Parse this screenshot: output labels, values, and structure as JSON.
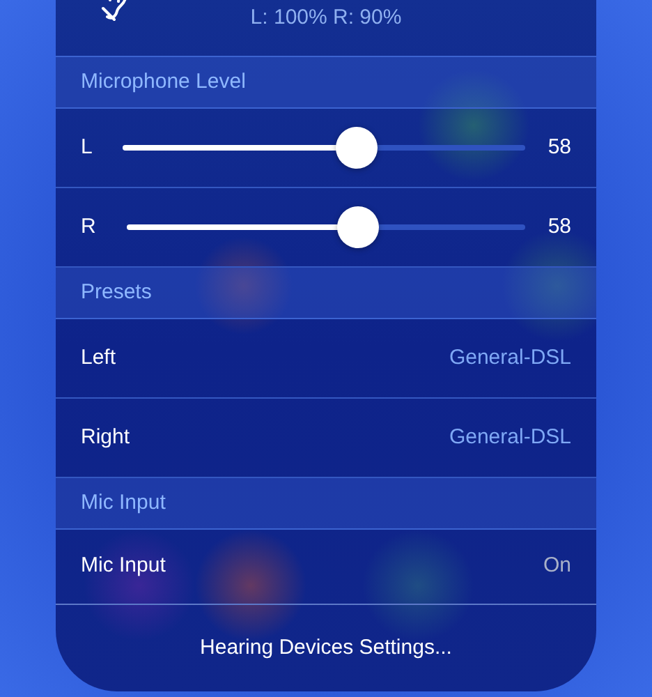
{
  "hearing_status": "L: 100% R: 90%",
  "sections": [
    {
      "title": "Microphone Level",
      "rows": [
        {
          "kind": "slider",
          "label": "L",
          "level": 0.58,
          "reading": "58"
        },
        {
          "kind": "slider",
          "label": "R",
          "level": 0.58,
          "reading": "58"
        }
      ]
    },
    {
      "title": "Presets",
      "rows": [
        {
          "kind": "choice",
          "label": "Left",
          "value": "General-DSL"
        },
        {
          "kind": "choice",
          "label": "Right",
          "value": "General-DSL"
        }
      ]
    },
    {
      "title": "Mic Input",
      "rows": [
        {
          "kind": "setting",
          "label": "Mic Input",
          "value": "On"
        }
      ]
    }
  ],
  "footer_link": "Hearing Devices Settings..."
}
